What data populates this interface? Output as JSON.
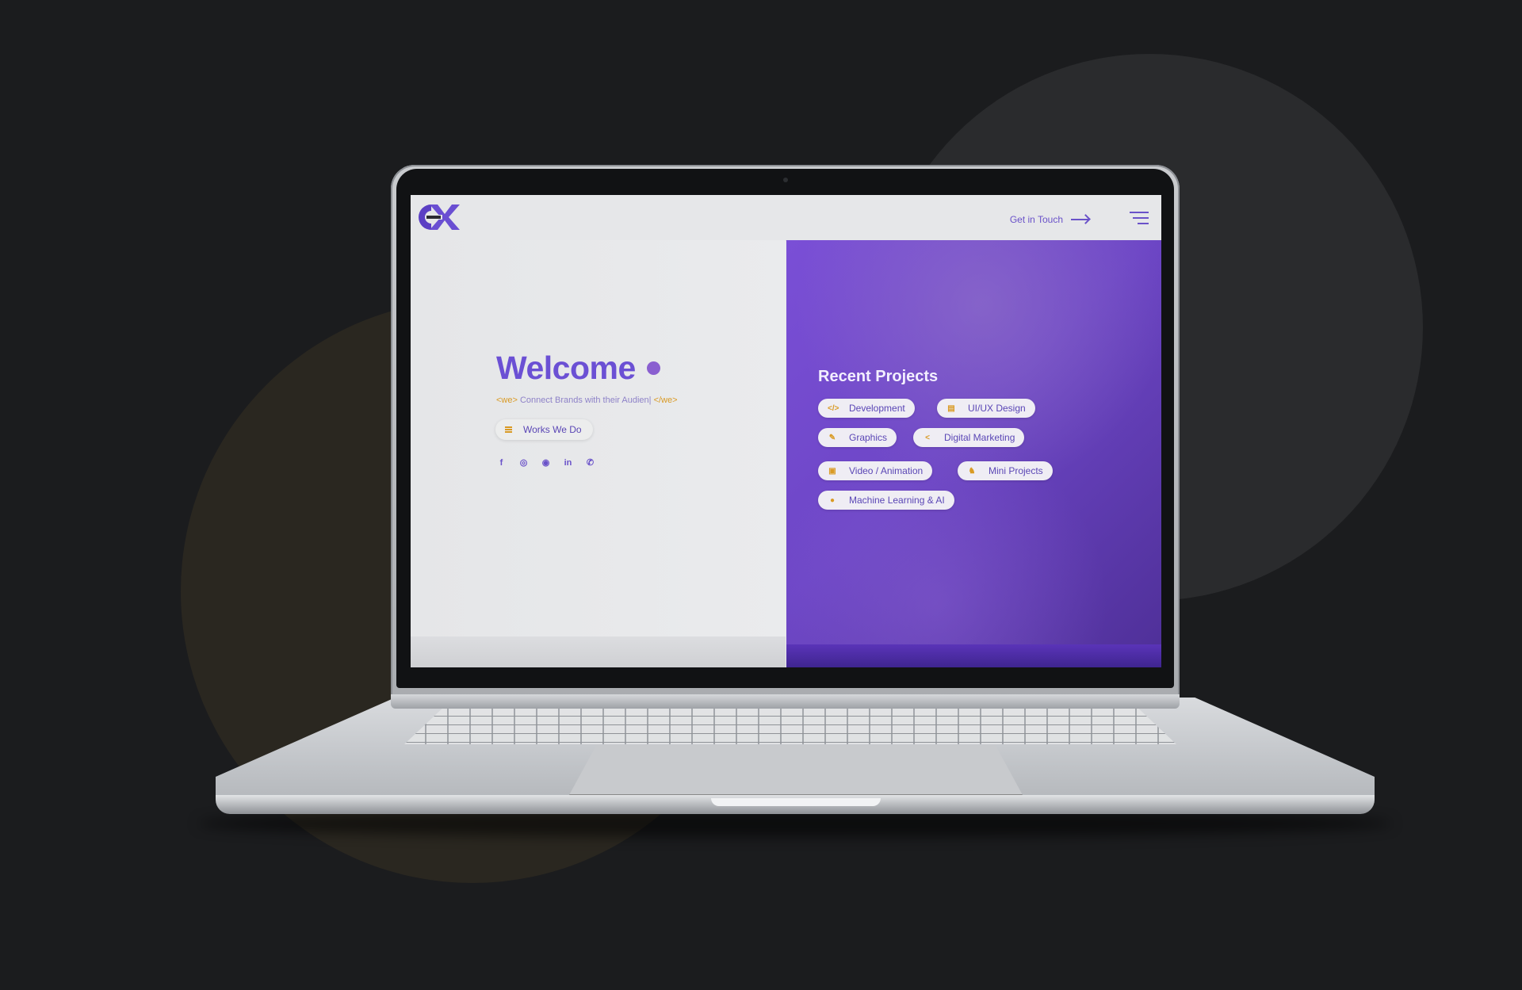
{
  "header": {
    "logo_text": "CX",
    "get_in_touch_label": "Get in Touch"
  },
  "hero": {
    "title": "Welcome",
    "tagline_open_tag": "<we>",
    "tagline_text": "Connect Brands with their Audien|",
    "tagline_close_tag": "</we>",
    "works_button_label": "Works We Do"
  },
  "socials": {
    "icons": [
      "facebook-icon",
      "instagram-icon",
      "github-icon",
      "linkedin-icon",
      "whatsapp-icon"
    ],
    "facebook": "f",
    "instagram": "◎",
    "github": "◉",
    "linkedin": "in",
    "whatsapp": "✆"
  },
  "projects": {
    "title": "Recent Projects",
    "items": [
      {
        "label": "Development",
        "icon": "code-icon",
        "glyph": "</>"
      },
      {
        "label": "UI/UX Design",
        "icon": "layers-icon",
        "glyph": "▤"
      },
      {
        "label": "Graphics",
        "icon": "brush-icon",
        "glyph": "✎"
      },
      {
        "label": "Digital Marketing",
        "icon": "share-icon",
        "glyph": "<"
      },
      {
        "label": "Video / Animation",
        "icon": "film-icon",
        "glyph": "▣"
      },
      {
        "label": "Mini Projects",
        "icon": "puzzle-icon",
        "glyph": "♞"
      },
      {
        "label": "Machine Learning & AI",
        "icon": "brain-icon",
        "glyph": "●"
      }
    ]
  },
  "colors": {
    "accent": "#6b50d4",
    "secondary": "#d99a24",
    "background": "#1b1c1e"
  }
}
